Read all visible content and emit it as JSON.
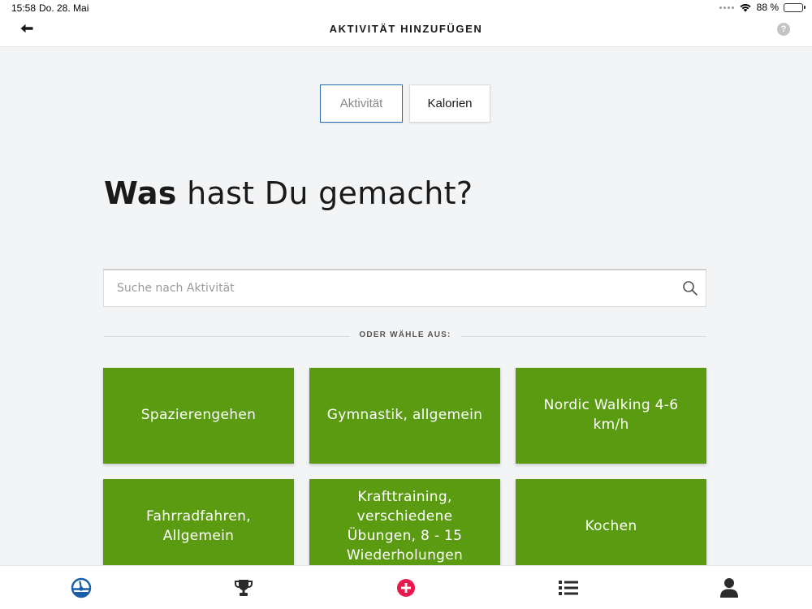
{
  "status_bar": {
    "time": "15:58",
    "date": "Do. 28. Mai",
    "battery": "88 %",
    "battery_level": 0.88
  },
  "header": {
    "title": "AKTIVITÄT HINZUFÜGEN",
    "help_label": "?"
  },
  "toggle": {
    "options": [
      {
        "label": "Aktivität",
        "active": true
      },
      {
        "label": "Kalorien",
        "active": false
      }
    ]
  },
  "heading": {
    "bold": "Was",
    "rest": " hast Du gemacht?"
  },
  "search": {
    "placeholder": "Suche nach Aktivität",
    "value": ""
  },
  "divider": {
    "label": "ODER WÄHLE AUS:"
  },
  "activities": [
    "Spazierengehen",
    "Gymnastik, allgemein",
    "Nordic Walking 4-6 km/h",
    "Fahrradfahren, Allgemein",
    "Krafttraining, verschiedene Übungen, 8 - 15 Wiederholungen",
    "Kochen"
  ],
  "bottom_nav": {
    "items": [
      "dashboard-icon",
      "trophy-icon",
      "add-icon",
      "list-icon",
      "profile-icon"
    ]
  },
  "colors": {
    "tile_green": "#5a9b12",
    "accent_blue": "#2c6fb0",
    "add_red": "#e8194f",
    "nav_blue": "#1a5ea6",
    "nav_dark": "#2b2b2b"
  }
}
